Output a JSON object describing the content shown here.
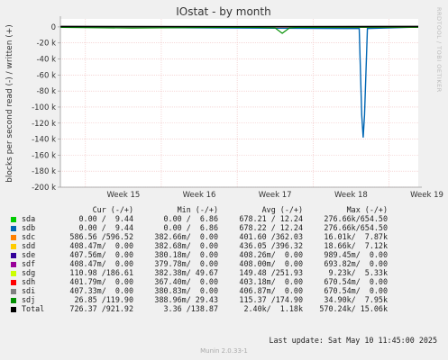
{
  "chart_data": {
    "type": "line",
    "title": "IOstat - by month",
    "ylabel": "blocks per second read (-) / written (+)",
    "ylim": [
      -200000,
      10000
    ],
    "y_ticks": [
      {
        "value": 0,
        "label": "0"
      },
      {
        "value": -20000,
        "label": "-20 k"
      },
      {
        "value": -40000,
        "label": "-40 k"
      },
      {
        "value": -60000,
        "label": "-60 k"
      },
      {
        "value": -80000,
        "label": "-80 k"
      },
      {
        "value": -100000,
        "label": "-100 k"
      },
      {
        "value": -120000,
        "label": "-120 k"
      },
      {
        "value": -140000,
        "label": "-140 k"
      },
      {
        "value": -160000,
        "label": "-160 k"
      },
      {
        "value": -180000,
        "label": "-180 k"
      },
      {
        "value": -200000,
        "label": "-200 k"
      }
    ],
    "x_ticks": [
      "Week 15",
      "Week 16",
      "Week 17",
      "Week 18",
      "Week 19"
    ],
    "grid": true,
    "series": [
      {
        "name": "sda",
        "color": "#00cc00",
        "x": [
          0,
          40,
          100
        ],
        "values": [
          -200,
          -300,
          -200
        ]
      },
      {
        "name": "sdb",
        "color": "#0066b3",
        "x": [
          0,
          83.5,
          84.2,
          84.6,
          85.0,
          85.8,
          100
        ],
        "values": [
          -200,
          -2000,
          -110000,
          -138000,
          -110000,
          -2000,
          -200
        ]
      },
      {
        "name": "sdc",
        "color": "#ff8000",
        "x": [
          0,
          50,
          100
        ],
        "values": [
          -400,
          -400,
          -400
        ]
      },
      {
        "name": "sdd",
        "color": "#ffcc00",
        "x": [
          0,
          50,
          100
        ],
        "values": [
          -300,
          -300,
          -300
        ]
      },
      {
        "name": "sde",
        "color": "#330099",
        "x": [
          0,
          50,
          100
        ],
        "values": [
          -400,
          -400,
          -400
        ]
      },
      {
        "name": "sdf",
        "color": "#990099",
        "x": [
          0,
          50,
          100
        ],
        "values": [
          -400,
          -400,
          -400
        ]
      },
      {
        "name": "sdg",
        "color": "#ccff00",
        "x": [
          0,
          50,
          100
        ],
        "values": [
          -400,
          -400,
          -400
        ]
      },
      {
        "name": "sdh",
        "color": "#ff0000",
        "x": [
          0,
          50,
          100
        ],
        "values": [
          -400,
          -400,
          -400
        ]
      },
      {
        "name": "sdi",
        "color": "#808080",
        "x": [
          0,
          50,
          100
        ],
        "values": [
          -400,
          -400,
          -400
        ]
      },
      {
        "name": "sdj",
        "color": "#008f00",
        "x": [
          0,
          20,
          40,
          55,
          60,
          62,
          64,
          66,
          70,
          100
        ],
        "values": [
          -600,
          -1500,
          -800,
          -600,
          -1200,
          -8000,
          -1200,
          -600,
          -500,
          -400
        ]
      },
      {
        "name": "Total",
        "color": "#000000",
        "x": [
          0,
          50,
          100
        ],
        "values": [
          800,
          600,
          800
        ]
      }
    ]
  },
  "legend": {
    "headers": {
      "cur": "Cur (-/+)",
      "min": "Min (-/+)",
      "avg": "Avg (-/+)",
      "max": "Max (-/+)"
    },
    "rows": [
      {
        "name": "sda",
        "color": "#00cc00",
        "cur": "0.00 /  9.44",
        "min": "0.00 /  6.86",
        "avg": "678.21 / 12.24",
        "max": "276.66k/654.50"
      },
      {
        "name": "sdb",
        "color": "#0066b3",
        "cur": "0.00 /  9.44",
        "min": "0.00 /  6.86",
        "avg": "678.22 / 12.24",
        "max": "276.66k/654.50"
      },
      {
        "name": "sdc",
        "color": "#ff8000",
        "cur": "586.56 /596.52",
        "min": "382.66m/  0.00",
        "avg": "401.60 /362.03",
        "max": "16.01k/  7.87k"
      },
      {
        "name": "sdd",
        "color": "#ffcc00",
        "cur": "408.47m/  0.00",
        "min": "382.68m/  0.00",
        "avg": "436.05 /396.32",
        "max": "18.66k/  7.12k"
      },
      {
        "name": "sde",
        "color": "#330099",
        "cur": "407.56m/  0.00",
        "min": "380.18m/  0.00",
        "avg": "408.26m/  0.00",
        "max": "989.45m/  0.00"
      },
      {
        "name": "sdf",
        "color": "#990099",
        "cur": "408.47m/  0.00",
        "min": "379.78m/  0.00",
        "avg": "408.00m/  0.00",
        "max": "693.82m/  0.00"
      },
      {
        "name": "sdg",
        "color": "#ccff00",
        "cur": "110.98 /186.61",
        "min": "382.38m/ 49.67",
        "avg": "149.48 /251.93",
        "max": "9.23k/  5.33k"
      },
      {
        "name": "sdh",
        "color": "#ff0000",
        "cur": "401.79m/  0.00",
        "min": "367.40m/  0.00",
        "avg": "403.18m/  0.00",
        "max": "670.54m/  0.00"
      },
      {
        "name": "sdi",
        "color": "#808080",
        "cur": "407.33m/  0.00",
        "min": "380.83m/  0.00",
        "avg": "406.87m/  0.00",
        "max": "670.54m/  0.00"
      },
      {
        "name": "sdj",
        "color": "#008f00",
        "cur": "26.85 /119.90",
        "min": "388.96m/ 29.43",
        "avg": "115.37 /174.90",
        "max": "34.90k/  7.95k"
      },
      {
        "name": "Total",
        "color": "#000000",
        "cur": "726.37 /921.92",
        "min": "3.36 /138.87",
        "avg": "2.40k/  1.18k",
        "max": "570.24k/ 15.06k"
      }
    ]
  },
  "footer": {
    "last_update": "Last update:  Sat May 10 11:45:00 2025",
    "munin": "Munin 2.0.33-1",
    "rrdtool": "RRDTOOL / TOBI OETIKER"
  }
}
